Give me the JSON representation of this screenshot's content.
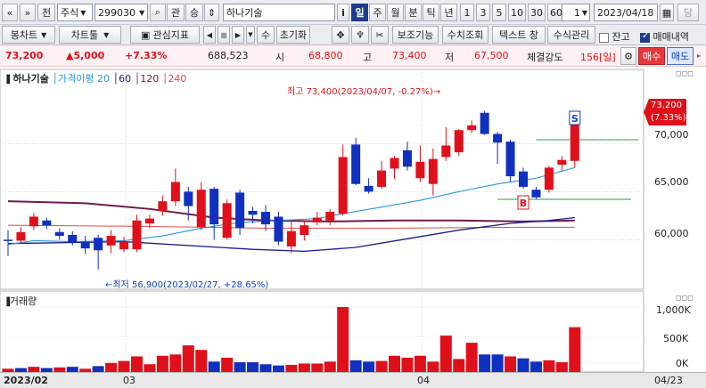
{
  "toolbar1": {
    "nav_prev": "«",
    "nav_up": "»",
    "jeon": "전",
    "type_label": "주식",
    "code": "299030",
    "search_icon": "⌕",
    "gwan": "관",
    "seung": "승",
    "spin": "⇕",
    "name": "하나기술",
    "info": "i",
    "periods": [
      "일",
      "주",
      "월",
      "분",
      "틱",
      "년"
    ],
    "active_period": "일",
    "counts": [
      "1",
      "3",
      "5",
      "10",
      "30",
      "60"
    ],
    "count_value": "1",
    "date": "2023/04/18",
    "cal": "▦",
    "dang": "당"
  },
  "toolbar2": {
    "bongchart": "봉차트",
    "charttool": "차트툴",
    "gwansim": "관심지표",
    "play_prev": "◀",
    "stop": "■",
    "play_next": "▶",
    "su": "수",
    "reset": "초기화",
    "move": "✥",
    "wand": "♆",
    "scissor": "✂",
    "bojo": "보조기능",
    "suchi": "수치조회",
    "text_win": "텍스트 창",
    "formula": "수식관리",
    "jango": "잔고",
    "maemae": "매매내역"
  },
  "quote": {
    "price": "73,200",
    "change": "▲5,000",
    "pct": "+7.33%",
    "volume": "688,523",
    "open_label": "시",
    "open": "68,800",
    "high_label": "고",
    "high": "73,400",
    "low_label": "저",
    "low": "67,500",
    "strength_label": "체결강도",
    "strength": "156[일]",
    "buy": "매수",
    "sell": "매도"
  },
  "legend": {
    "name": "하나기술",
    "ma_label": "가격이평",
    "ma": [
      "20",
      "60",
      "120",
      "240"
    ]
  },
  "annotations": {
    "high": "최고 73,400(2023/04/07, -0.27%)→",
    "low": "←최저 56,900(2023/02/27, +28.65%)",
    "s_mark": "S",
    "b_mark": "B"
  },
  "price_axis": {
    "labels": [
      "70,000",
      "65,000",
      "60,000"
    ],
    "current": "73,200",
    "current_pct": "(7.33%)"
  },
  "volume": {
    "title": "거래량",
    "labels": [
      "1,000K",
      "500K",
      "0K"
    ]
  },
  "dates": {
    "start": "2023/02",
    "m03": "03",
    "m04": "04",
    "end": "04/23"
  },
  "colors": {
    "up": "#e0101a",
    "down": "#1030c0",
    "ma20": "#2a96d8",
    "ma60": "#1a1a8c",
    "ma120": "#6e1a4e",
    "ma240": "#e04a4a"
  },
  "chart_data": {
    "type": "candlestick",
    "candles": [
      [
        60000,
        59900,
        61000,
        58300,
        "down"
      ],
      [
        59900,
        60800,
        61300,
        59600,
        "up"
      ],
      [
        61400,
        62400,
        62800,
        61000,
        "up"
      ],
      [
        62000,
        61500,
        62300,
        61100,
        "down"
      ],
      [
        60800,
        60400,
        61200,
        60000,
        "down"
      ],
      [
        60500,
        59700,
        60900,
        59400,
        "down"
      ],
      [
        59800,
        59100,
        60400,
        58500,
        "down"
      ],
      [
        60200,
        58900,
        60500,
        56900,
        "down"
      ],
      [
        59400,
        60400,
        61000,
        58600,
        "up"
      ],
      [
        59000,
        59800,
        60300,
        58700,
        "up"
      ],
      [
        59000,
        62000,
        62600,
        58700,
        "up"
      ],
      [
        61700,
        62200,
        62600,
        61200,
        "up"
      ],
      [
        63000,
        64000,
        64600,
        62500,
        "up"
      ],
      [
        64000,
        66000,
        67400,
        63500,
        "up"
      ],
      [
        65000,
        63500,
        65500,
        62000,
        "down"
      ],
      [
        61300,
        65200,
        66000,
        61000,
        "up"
      ],
      [
        65300,
        61600,
        65500,
        60000,
        "down"
      ],
      [
        60200,
        63800,
        64200,
        60000,
        "up"
      ],
      [
        64900,
        61200,
        65200,
        60500,
        "down"
      ],
      [
        63000,
        62600,
        63400,
        61700,
        "down"
      ],
      [
        62900,
        61600,
        63600,
        60900,
        "down"
      ],
      [
        62400,
        59800,
        62900,
        59400,
        "down"
      ],
      [
        59300,
        60900,
        62000,
        58600,
        "up"
      ],
      [
        60500,
        61500,
        62000,
        59900,
        "up"
      ],
      [
        61800,
        62300,
        62900,
        61500,
        "up"
      ],
      [
        62000,
        62900,
        63200,
        61500,
        "up"
      ],
      [
        62700,
        68600,
        69900,
        62500,
        "up"
      ],
      [
        69900,
        65800,
        70600,
        65700,
        "down"
      ],
      [
        65000,
        65600,
        66400,
        64800,
        "down"
      ],
      [
        65500,
        67200,
        68200,
        65300,
        "up"
      ],
      [
        67400,
        68500,
        68700,
        66300,
        "up"
      ],
      [
        69300,
        67600,
        70200,
        67200,
        "down"
      ],
      [
        66400,
        68100,
        69800,
        66000,
        "up"
      ],
      [
        65800,
        68400,
        69500,
        64600,
        "up"
      ],
      [
        68600,
        69800,
        71700,
        68200,
        "up"
      ],
      [
        69100,
        71400,
        71500,
        68700,
        "up"
      ],
      [
        71400,
        71900,
        72400,
        71100,
        "up"
      ],
      [
        73200,
        71000,
        73400,
        70900,
        "down"
      ],
      [
        71000,
        70100,
        71200,
        67900,
        "down"
      ],
      [
        70200,
        66600,
        70400,
        66000,
        "down"
      ],
      [
        67100,
        65500,
        67500,
        65300,
        "down"
      ],
      [
        64400,
        65200,
        65500,
        64200,
        "down"
      ],
      [
        65200,
        67500,
        67700,
        64900,
        "up"
      ],
      [
        67800,
        68300,
        68700,
        67200,
        "up"
      ],
      [
        68200,
        73200,
        73400,
        67500,
        "up"
      ]
    ],
    "volumes": [
      [
        50,
        "up"
      ],
      [
        60,
        "down"
      ],
      [
        80,
        "up"
      ],
      [
        60,
        "down"
      ],
      [
        70,
        "up"
      ],
      [
        80,
        "down"
      ],
      [
        50,
        "up"
      ],
      [
        90,
        "down"
      ],
      [
        140,
        "up"
      ],
      [
        170,
        "up"
      ],
      [
        240,
        "up"
      ],
      [
        120,
        "up"
      ],
      [
        250,
        "up"
      ],
      [
        270,
        "up"
      ],
      [
        410,
        "up"
      ],
      [
        340,
        "up"
      ],
      [
        160,
        "down"
      ],
      [
        220,
        "up"
      ],
      [
        150,
        "down"
      ],
      [
        150,
        "down"
      ],
      [
        120,
        "down"
      ],
      [
        100,
        "down"
      ],
      [
        110,
        "up"
      ],
      [
        130,
        "up"
      ],
      [
        130,
        "up"
      ],
      [
        160,
        "up"
      ],
      [
        1000,
        "up"
      ],
      [
        180,
        "down"
      ],
      [
        160,
        "down"
      ],
      [
        170,
        "up"
      ],
      [
        250,
        "up"
      ],
      [
        220,
        "up"
      ],
      [
        250,
        "up"
      ],
      [
        160,
        "up"
      ],
      [
        560,
        "up"
      ],
      [
        200,
        "up"
      ],
      [
        450,
        "up"
      ],
      [
        270,
        "down"
      ],
      [
        270,
        "down"
      ],
      [
        240,
        "up"
      ],
      [
        210,
        "down"
      ],
      [
        160,
        "down"
      ],
      [
        180,
        "up"
      ],
      [
        150,
        "up"
      ],
      [
        690,
        "up"
      ]
    ],
    "ma20": [
      [
        0,
        59500
      ],
      [
        2,
        59900
      ],
      [
        5,
        59800
      ],
      [
        9,
        59900
      ],
      [
        12,
        60400
      ],
      [
        15,
        61200
      ],
      [
        18,
        61800
      ],
      [
        21,
        62000
      ],
      [
        24,
        62200
      ],
      [
        26,
        62700
      ],
      [
        29,
        63400
      ],
      [
        32,
        64100
      ],
      [
        35,
        65000
      ],
      [
        38,
        65800
      ],
      [
        41,
        66400
      ],
      [
        44,
        67500
      ]
    ],
    "ma60": [
      [
        0,
        59600
      ],
      [
        9,
        59800
      ],
      [
        19,
        59000
      ],
      [
        23,
        58800
      ],
      [
        27,
        59200
      ],
      [
        31,
        60100
      ],
      [
        35,
        61000
      ],
      [
        39,
        61700
      ],
      [
        42,
        62000
      ],
      [
        44,
        62300
      ]
    ],
    "ma120": [
      [
        0,
        64000
      ],
      [
        6,
        63800
      ],
      [
        11,
        63200
      ],
      [
        16,
        62300
      ],
      [
        20,
        62000
      ],
      [
        25,
        61900
      ],
      [
        30,
        62000
      ],
      [
        35,
        62000
      ],
      [
        40,
        61900
      ],
      [
        44,
        62000
      ]
    ],
    "ma240": [
      [
        0,
        61500
      ],
      [
        10,
        61400
      ],
      [
        20,
        61200
      ],
      [
        30,
        61200
      ],
      [
        40,
        61300
      ],
      [
        44,
        61300
      ]
    ],
    "ylim": [
      55500,
      75400
    ],
    "vol_max": 1000,
    "resist_line": 70400,
    "support_line": 64200,
    "s_index": 44,
    "b_index": 40
  }
}
